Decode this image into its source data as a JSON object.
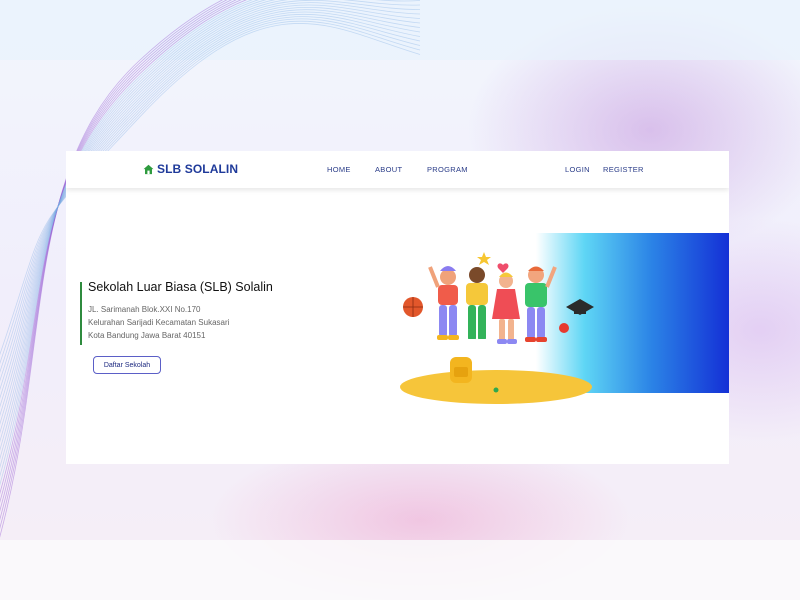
{
  "brand": {
    "name": "SLB SOLALIN",
    "icon": "home-icon",
    "accent_color": "#2e9b3e",
    "primary_color": "#1f3a9a"
  },
  "nav": {
    "links": [
      "HOME",
      "ABOUT",
      "PROGRAM"
    ],
    "login": "LOGIN",
    "register": "REGISTER"
  },
  "hero": {
    "title": "Sekolah Luar Biasa (SLB) Solalin",
    "address_lines": [
      "JL. Sarimanah Blok.XXI No.170",
      "Kelurahan Sarijadi Kecamatan Sukasari",
      "Kota Bandung Jawa Barat 40151"
    ],
    "cta_label": "Daftar Sekolah",
    "illustration": "group-of-students-illustration"
  }
}
